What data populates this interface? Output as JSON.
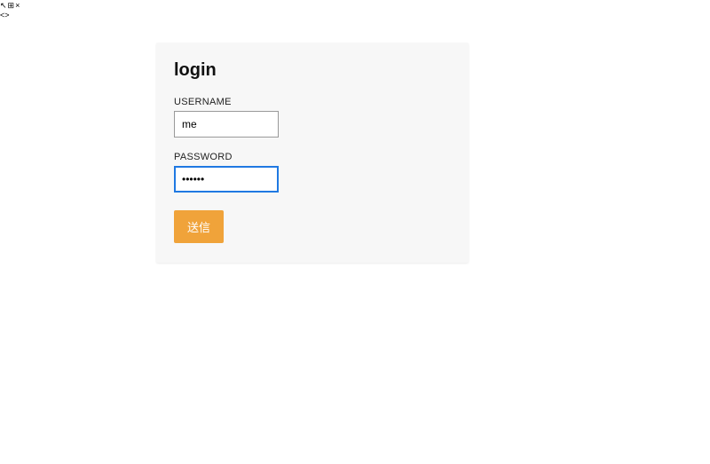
{
  "toolbar": {
    "icons": [
      "↖",
      "⊞",
      "×",
      "<>"
    ]
  },
  "panel": {
    "title": "login",
    "username_label": "USERNAME",
    "username_value": "me",
    "password_label": "PASSWORD",
    "password_value": "••••••",
    "submit_label": "送信"
  }
}
